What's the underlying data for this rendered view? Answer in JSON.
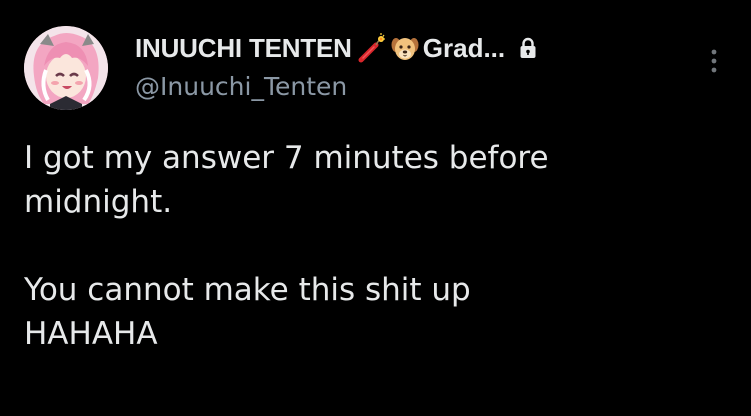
{
  "author": {
    "display_name": "INUUCHI TENTEN",
    "name_suffix": "Grad...",
    "handle": "@Inuuchi_Tenten",
    "emojis": [
      "firecracker-emoji",
      "dog-face-emoji"
    ],
    "protected": true
  },
  "tweet": {
    "lines": [
      "I got my answer 7 minutes before",
      "midnight.",
      "You cannot make this shit up",
      "HAHAHA"
    ]
  },
  "colors": {
    "background": "#000000",
    "text": "#e7e9ea",
    "secondary_text": "#8b98a5",
    "avatar_hair": "#f3a6c2"
  },
  "icons": {
    "more": "more-vertical-icon",
    "lock": "lock-icon"
  }
}
